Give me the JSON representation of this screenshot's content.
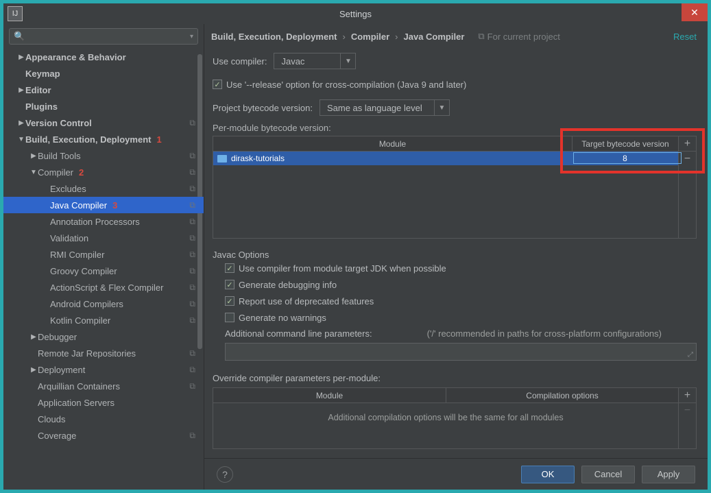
{
  "window": {
    "title": "Settings"
  },
  "breadcrumb": {
    "a": "Build, Execution, Deployment",
    "b": "Compiler",
    "c": "Java Compiler",
    "for_project": "For current project",
    "reset": "Reset"
  },
  "sidebar": {
    "items": [
      {
        "label": "Appearance & Behavior",
        "bold": true,
        "arrow": "▶",
        "indent": 0
      },
      {
        "label": "Keymap",
        "bold": true,
        "arrow": "",
        "indent": 0
      },
      {
        "label": "Editor",
        "bold": true,
        "arrow": "▶",
        "indent": 0
      },
      {
        "label": "Plugins",
        "bold": true,
        "arrow": "",
        "indent": 0
      },
      {
        "label": "Version Control",
        "bold": true,
        "arrow": "▶",
        "indent": 0,
        "badge": "⧉"
      },
      {
        "label": "Build, Execution, Deployment",
        "bold": true,
        "arrow": "▼",
        "indent": 0,
        "mark": "1"
      },
      {
        "label": "Build Tools",
        "bold": false,
        "arrow": "▶",
        "indent": 1,
        "badge": "⧉"
      },
      {
        "label": "Compiler",
        "bold": false,
        "arrow": "▼",
        "indent": 1,
        "badge": "⧉",
        "mark": "2"
      },
      {
        "label": "Excludes",
        "bold": false,
        "arrow": "",
        "indent": 2,
        "badge": "⧉"
      },
      {
        "label": "Java Compiler",
        "bold": false,
        "arrow": "",
        "indent": 2,
        "badge": "⧉",
        "selected": true,
        "mark": "3"
      },
      {
        "label": "Annotation Processors",
        "bold": false,
        "arrow": "",
        "indent": 2,
        "badge": "⧉"
      },
      {
        "label": "Validation",
        "bold": false,
        "arrow": "",
        "indent": 2,
        "badge": "⧉"
      },
      {
        "label": "RMI Compiler",
        "bold": false,
        "arrow": "",
        "indent": 2,
        "badge": "⧉"
      },
      {
        "label": "Groovy Compiler",
        "bold": false,
        "arrow": "",
        "indent": 2,
        "badge": "⧉"
      },
      {
        "label": "ActionScript & Flex Compiler",
        "bold": false,
        "arrow": "",
        "indent": 2,
        "badge": "⧉"
      },
      {
        "label": "Android Compilers",
        "bold": false,
        "arrow": "",
        "indent": 2,
        "badge": "⧉"
      },
      {
        "label": "Kotlin Compiler",
        "bold": false,
        "arrow": "",
        "indent": 2,
        "badge": "⧉"
      },
      {
        "label": "Debugger",
        "bold": false,
        "arrow": "▶",
        "indent": 1
      },
      {
        "label": "Remote Jar Repositories",
        "bold": false,
        "arrow": "",
        "indent": 1,
        "badge": "⧉"
      },
      {
        "label": "Deployment",
        "bold": false,
        "arrow": "▶",
        "indent": 1,
        "badge": "⧉"
      },
      {
        "label": "Arquillian Containers",
        "bold": false,
        "arrow": "",
        "indent": 1,
        "badge": "⧉"
      },
      {
        "label": "Application Servers",
        "bold": false,
        "arrow": "",
        "indent": 1
      },
      {
        "label": "Clouds",
        "bold": false,
        "arrow": "",
        "indent": 1
      },
      {
        "label": "Coverage",
        "bold": false,
        "arrow": "",
        "indent": 1,
        "badge": "⧉"
      }
    ]
  },
  "compiler": {
    "use_label": "Use compiler:",
    "use_value": "Javac",
    "release_option": "Use '--release' option for cross-compilation (Java 9 and later)",
    "project_bytecode_label": "Project bytecode version:",
    "project_bytecode_value": "Same as language level",
    "per_module_label": "Per-module bytecode version:",
    "module_header": "Module",
    "target_header": "Target bytecode version",
    "module_name": "dirask-tutorials",
    "target_value": "8"
  },
  "javac": {
    "title": "Javac Options",
    "opt1": "Use compiler from module target JDK when possible",
    "opt2": "Generate debugging info",
    "opt3": "Report use of deprecated features",
    "opt4": "Generate no warnings",
    "cmdline_label": "Additional command line parameters:",
    "cmdline_hint": "('/' recommended in paths for cross-platform configurations)"
  },
  "override": {
    "label": "Override compiler parameters per-module:",
    "col1": "Module",
    "col2": "Compilation options",
    "msg": "Additional compilation options will be the same for all modules"
  },
  "buttons": {
    "ok": "OK",
    "cancel": "Cancel",
    "apply": "Apply"
  }
}
